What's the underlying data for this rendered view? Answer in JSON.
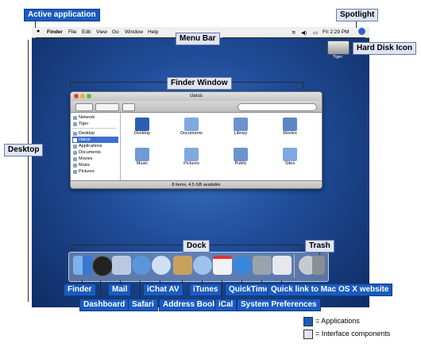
{
  "menubar": {
    "apple": "●",
    "items": [
      "Finder",
      "File",
      "Edit",
      "View",
      "Go",
      "Window",
      "Help"
    ],
    "clock": "Fri 2:29 PM"
  },
  "desktop": {
    "hd_name": "Tiger"
  },
  "finder": {
    "title": "clarus",
    "sidebar": [
      "Network",
      "Tiger",
      "Desktop",
      "clarus",
      "Applications",
      "Documents",
      "Movies",
      "Music",
      "Pictures"
    ],
    "items": [
      "Desktop",
      "Documents",
      "Library",
      "Movies",
      "Music",
      "Pictures",
      "Public",
      "Sites"
    ],
    "status": "8 items, 4.5 GB available"
  },
  "callouts": {
    "active_application": "Active application",
    "spotlight": "Spotlight",
    "menu_bar": "Menu Bar",
    "hard_disk_icon": "Hard Disk Icon",
    "finder_window": "Finder Window",
    "desktop": "Desktop",
    "dock": "Dock",
    "trash": "Trash",
    "finder": "Finder",
    "dashboard": "Dashboard",
    "mail": "Mail",
    "safari": "Safari",
    "ichat_av": "iChat AV",
    "address_book": "Address Book",
    "itunes": "iTunes",
    "ical": "iCal",
    "quicktime": "QuickTime",
    "system_preferences": "System Preferences",
    "quick_link": "Quick link to Mac OS X website"
  },
  "legend": {
    "applications": "= Applications",
    "interface": "= Interface components"
  },
  "colors": {
    "application_label": "#1a5bbf",
    "interface_label": "#dfe4f2",
    "desktop_blue": "#1f4c98",
    "selection": "#3b6fd1"
  },
  "icons": {
    "dock": [
      "finder-icon",
      "dashboard-icon",
      "mail-icon",
      "safari-icon",
      "ichat-icon",
      "address-book-icon",
      "itunes-icon",
      "ical-icon",
      "quicktime-icon",
      "system-preferences-icon",
      "apple-website-icon",
      "trash-icon"
    ]
  }
}
